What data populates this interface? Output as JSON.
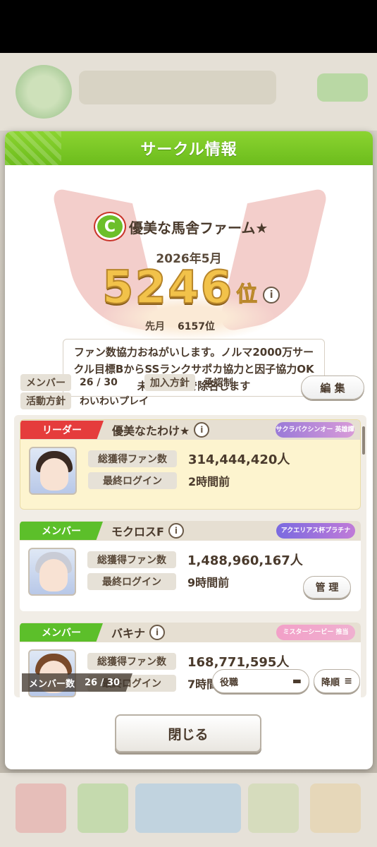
{
  "modal": {
    "title": "サークル情報",
    "close_label": "閉じる"
  },
  "circle": {
    "emblem_letter": "C",
    "name": "優美な馬舎ファーム★",
    "month": "2026年5月",
    "rank": "5246",
    "rank_suffix": "位",
    "last_month_label": "先月",
    "last_month_rank": "6157位",
    "comment": "ファン数協力おねがいします。ノルマ2000万サークル目標BからSSランクサポカ協力と因子協力OK未ログ7日で除名します",
    "members_label": "メンバー",
    "members_value": "26 / 30",
    "join_policy_label": "加入方針",
    "join_policy_value": "承認制",
    "activity_label": "活動方針",
    "activity_value": "わいわいプレイ",
    "edit_label": "編 集"
  },
  "info_glyph": "i",
  "members": [
    {
      "role": "リーダー",
      "name": "優美なたわけ★",
      "badge": "サクラバクシンオー 英雄譚",
      "fans_label": "総獲得ファン数",
      "fans": "314,444,420人",
      "login_label": "最終ログイン",
      "login": "2時間前"
    },
    {
      "role": "メンバー",
      "name": "モクロスF",
      "badge": "アクエリアス杯プラチナ",
      "fans_label": "総獲得ファン数",
      "fans": "1,488,960,167人",
      "login_label": "最終ログイン",
      "login": "9時間前",
      "manage_label": "管 理"
    },
    {
      "role": "メンバー",
      "name": "バキナ",
      "badge": "ミスターシービー 推当",
      "fans_label": "総獲得ファン数",
      "fans": "168,771,595人",
      "login_label": "最終ログイン",
      "login": "7時間"
    }
  ],
  "list_footer": {
    "count_label": "メンバー数",
    "count_value": "26 / 30",
    "role_sort_label": "役職",
    "order_label": "降順"
  },
  "colors": {
    "header_green": "#6cbc1c",
    "leader_red": "#e53c3c",
    "member_green": "#5cbf2a",
    "rank_gold": "#f2c24a"
  }
}
